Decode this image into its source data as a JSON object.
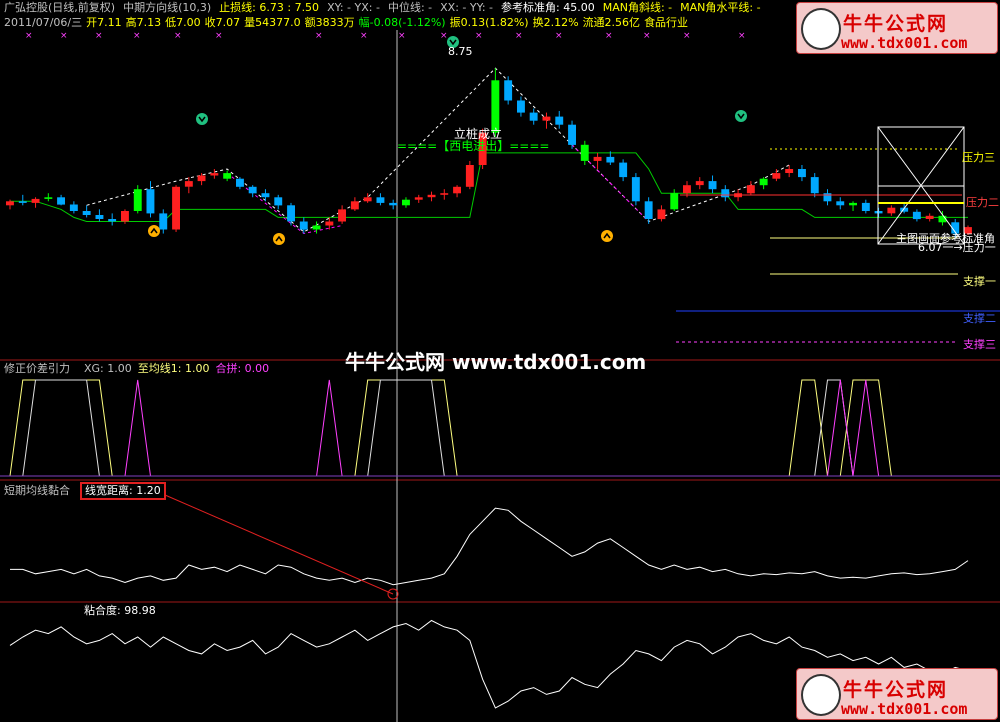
{
  "header": {
    "line1": [
      {
        "t": "广弘控股(日线,前复权)",
        "c": "#c0c0c0"
      },
      {
        "t": "中期方向线(10,3)",
        "c": "#c0c0c0"
      },
      {
        "t": "止损线: 6.73 : 7.50",
        "c": "#ffff00"
      },
      {
        "t": "XY: -  YX: -",
        "c": "#c0c0c0"
      },
      {
        "t": "中位线: -",
        "c": "#c0c0c0"
      },
      {
        "t": "XX: -  YY: -",
        "c": "#c0c0c0"
      },
      {
        "t": "参考标准角: 45.00",
        "c": "#ffffff"
      },
      {
        "t": "MAN角斜线: -",
        "c": "#ffff00"
      },
      {
        "t": "MAN角水平线: -",
        "c": "#ffff00"
      }
    ],
    "line2": [
      {
        "t": "2011/07/06/三",
        "c": "#c0c0c0"
      },
      {
        "t": "开7.11",
        "c": "#ffff00"
      },
      {
        "t": "高7.13",
        "c": "#ffff00"
      },
      {
        "t": "低7.00",
        "c": "#ffff00"
      },
      {
        "t": "收7.07",
        "c": "#ffff00"
      },
      {
        "t": "量54377.0",
        "c": "#ffff00"
      },
      {
        "t": "额3833万",
        "c": "#ffff00"
      },
      {
        "t": "幅-0.08(-1.12%)",
        "c": "#00ff00"
      },
      {
        "t": "振0.13(1.82%)",
        "c": "#ffff00"
      },
      {
        "t": "换2.12%",
        "c": "#ffff00"
      },
      {
        "t": "流通2.56亿",
        "c": "#ffff00"
      },
      {
        "t": "食品行业",
        "c": "#ffff00"
      }
    ]
  },
  "watermark": {
    "site_name": "牛牛公式网",
    "url": "www.tdx001.com",
    "center_text": "牛牛公式网 www.tdx001.com"
  },
  "main_panel": {
    "price_high_label": "8.75",
    "annotation_1": "立桩成立",
    "annotation_2": "====【西电进出】====",
    "right_labels": [
      "压力三",
      "压力二",
      "主图画面参考标准角",
      "6.07一→压力一",
      "支撑一",
      "支撑二",
      "支撑三"
    ],
    "colors": {
      "up": "#ff2020",
      "down": "#00a8ff",
      "flat_up": "#00ff00",
      "stop_line": "#00cc00",
      "dash": "#ffffff",
      "magenta": "#ff00ff"
    }
  },
  "panel2": {
    "title": "修正价差引力",
    "legend": [
      {
        "t": "XG: 1.00",
        "c": "#c0c0c0"
      },
      {
        "t": "至均线1: 1.00",
        "c": "#ffff80"
      },
      {
        "t": "合拼: 0.00",
        "c": "#ff40ff"
      }
    ]
  },
  "panel3": {
    "title": "短期均线黏合",
    "legend": "线宽距离: 1.20"
  },
  "panel4": {
    "legend": "粘合度: 98.98"
  },
  "chart_data": {
    "type": "line",
    "candles": [
      [
        7.05,
        7.12,
        7.0,
        7.1
      ],
      [
        7.1,
        7.18,
        7.05,
        7.08
      ],
      [
        7.08,
        7.15,
        7.02,
        7.13
      ],
      [
        7.13,
        7.2,
        7.1,
        7.15
      ],
      [
        7.15,
        7.18,
        7.05,
        7.06
      ],
      [
        7.06,
        7.1,
        6.95,
        6.98
      ],
      [
        6.98,
        7.05,
        6.9,
        6.93
      ],
      [
        6.93,
        7.0,
        6.85,
        6.88
      ],
      [
        6.88,
        6.95,
        6.8,
        6.85
      ],
      [
        6.85,
        7.0,
        6.82,
        6.98
      ],
      [
        6.98,
        7.3,
        6.95,
        7.25
      ],
      [
        7.25,
        7.35,
        6.9,
        6.95
      ],
      [
        6.95,
        7.0,
        6.7,
        6.75
      ],
      [
        6.75,
        7.3,
        6.72,
        7.28
      ],
      [
        7.28,
        7.4,
        7.2,
        7.35
      ],
      [
        7.35,
        7.45,
        7.3,
        7.42
      ],
      [
        7.42,
        7.5,
        7.38,
        7.45
      ],
      [
        7.45,
        7.48,
        7.35,
        7.38
      ],
      [
        7.38,
        7.4,
        7.25,
        7.28
      ],
      [
        7.28,
        7.3,
        7.15,
        7.2
      ],
      [
        7.2,
        7.25,
        7.1,
        7.15
      ],
      [
        7.15,
        7.18,
        7.0,
        7.05
      ],
      [
        7.05,
        7.08,
        6.8,
        6.85
      ],
      [
        6.85,
        6.9,
        6.7,
        6.75
      ],
      [
        6.75,
        6.85,
        6.7,
        6.8
      ],
      [
        6.8,
        6.9,
        6.75,
        6.85
      ],
      [
        6.85,
        7.05,
        6.82,
        7.0
      ],
      [
        7.0,
        7.15,
        6.98,
        7.1
      ],
      [
        7.1,
        7.2,
        7.08,
        7.15
      ],
      [
        7.15,
        7.2,
        7.05,
        7.08
      ],
      [
        7.08,
        7.12,
        7.0,
        7.05
      ],
      [
        7.05,
        7.15,
        7.02,
        7.12
      ],
      [
        7.12,
        7.18,
        7.08,
        7.15
      ],
      [
        7.15,
        7.22,
        7.1,
        7.18
      ],
      [
        7.18,
        7.25,
        7.12,
        7.2
      ],
      [
        7.2,
        7.3,
        7.15,
        7.28
      ],
      [
        7.28,
        7.6,
        7.25,
        7.55
      ],
      [
        7.55,
        8.0,
        7.5,
        7.95
      ],
      [
        7.95,
        8.75,
        7.9,
        8.6
      ],
      [
        8.6,
        8.65,
        8.3,
        8.35
      ],
      [
        8.35,
        8.4,
        8.15,
        8.2
      ],
      [
        8.2,
        8.25,
        8.05,
        8.1
      ],
      [
        8.1,
        8.2,
        8.0,
        8.15
      ],
      [
        8.15,
        8.22,
        8.0,
        8.05
      ],
      [
        8.05,
        8.1,
        7.75,
        7.8
      ],
      [
        7.8,
        7.85,
        7.55,
        7.6
      ],
      [
        7.6,
        7.7,
        7.5,
        7.65
      ],
      [
        7.65,
        7.72,
        7.55,
        7.58
      ],
      [
        7.58,
        7.62,
        7.35,
        7.4
      ],
      [
        7.4,
        7.45,
        7.05,
        7.1
      ],
      [
        7.1,
        7.15,
        6.82,
        6.88
      ],
      [
        6.88,
        7.05,
        6.85,
        7.0
      ],
      [
        7.0,
        7.25,
        6.98,
        7.2
      ],
      [
        7.2,
        7.35,
        7.15,
        7.3
      ],
      [
        7.3,
        7.4,
        7.25,
        7.35
      ],
      [
        7.35,
        7.42,
        7.2,
        7.25
      ],
      [
        7.25,
        7.3,
        7.1,
        7.15
      ],
      [
        7.15,
        7.25,
        7.1,
        7.2
      ],
      [
        7.2,
        7.35,
        7.18,
        7.3
      ],
      [
        7.3,
        7.4,
        7.25,
        7.38
      ],
      [
        7.38,
        7.5,
        7.35,
        7.45
      ],
      [
        7.45,
        7.55,
        7.4,
        7.5
      ],
      [
        7.5,
        7.55,
        7.35,
        7.4
      ],
      [
        7.4,
        7.45,
        7.15,
        7.2
      ],
      [
        7.2,
        7.25,
        7.05,
        7.1
      ],
      [
        7.1,
        7.15,
        7.0,
        7.05
      ],
      [
        7.05,
        7.1,
        6.98,
        7.08
      ],
      [
        7.08,
        7.12,
        6.95,
        6.98
      ],
      [
        6.98,
        7.02,
        6.9,
        6.95
      ],
      [
        6.95,
        7.05,
        6.92,
        7.02
      ],
      [
        7.02,
        7.08,
        6.95,
        6.97
      ],
      [
        6.97,
        7.0,
        6.85,
        6.88
      ],
      [
        6.88,
        6.95,
        6.85,
        6.92
      ],
      [
        6.92,
        6.98,
        6.8,
        6.84
      ],
      [
        6.84,
        6.88,
        6.65,
        6.7
      ],
      [
        6.7,
        6.8,
        6.68,
        6.78
      ]
    ],
    "stop_line": [
      7.1,
      7.1,
      7.1,
      7.05,
      7.0,
      6.9,
      6.85,
      6.85,
      6.85,
      6.85,
      6.85,
      6.85,
      6.85,
      7.0,
      7.0,
      7.0,
      7.0,
      7.0,
      7.0,
      7.0,
      7.0,
      6.9,
      6.9,
      6.9,
      6.9,
      6.9,
      6.9,
      6.9,
      6.9,
      6.9,
      6.9,
      6.9,
      6.9,
      6.9,
      6.9,
      6.9,
      6.9,
      7.7,
      7.7,
      7.7,
      7.7,
      7.7,
      7.7,
      7.7,
      7.7,
      7.7,
      7.7,
      7.7,
      7.7,
      7.7,
      7.5,
      7.2,
      7.2,
      7.2,
      7.2,
      7.2,
      7.2,
      7.0,
      7.0,
      7.0,
      7.0,
      7.0,
      7.0,
      6.9,
      6.9,
      6.9,
      6.9,
      6.9,
      6.9,
      6.9,
      6.9,
      6.9,
      6.9,
      6.9,
      6.9,
      6.9
    ],
    "panel2_xg": [
      0,
      0,
      1,
      1,
      1,
      1,
      1,
      0,
      0,
      0,
      0,
      0,
      0,
      0,
      0,
      0,
      0,
      0,
      0,
      0,
      0,
      0,
      0,
      0,
      0,
      0,
      0,
      0,
      0,
      1,
      1,
      1,
      1,
      1,
      0,
      0,
      0,
      0,
      0,
      0,
      0,
      0,
      0,
      0,
      0,
      0,
      0,
      0,
      0,
      0,
      0,
      0,
      0,
      0,
      0,
      0,
      0,
      0,
      0,
      0,
      0,
      0,
      0,
      0,
      1,
      1,
      0,
      0,
      0,
      0,
      0,
      0,
      0,
      0,
      0,
      0
    ],
    "panel2_ma": [
      0,
      1,
      1,
      1,
      1,
      1,
      1,
      1,
      0,
      0,
      0,
      0,
      0,
      0,
      0,
      0,
      0,
      0,
      0,
      0,
      0,
      0,
      0,
      0,
      0,
      0,
      0,
      0,
      1,
      1,
      1,
      1,
      1,
      1,
      1,
      0,
      0,
      0,
      0,
      0,
      0,
      0,
      0,
      0,
      0,
      0,
      0,
      0,
      0,
      0,
      0,
      0,
      0,
      0,
      0,
      0,
      0,
      0,
      0,
      0,
      0,
      0,
      1,
      1,
      0,
      0,
      1,
      1,
      1,
      0,
      0,
      0,
      0,
      0,
      0,
      0
    ],
    "panel2_hp": [
      0,
      0,
      0,
      0,
      0,
      0,
      0,
      0,
      0,
      0,
      1,
      0,
      0,
      0,
      0,
      0,
      0,
      0,
      0,
      0,
      0,
      0,
      0,
      0,
      0,
      1,
      0,
      0,
      0,
      0,
      0,
      0,
      0,
      0,
      0,
      0,
      0,
      0,
      0,
      0,
      0,
      0,
      0,
      0,
      0,
      0,
      0,
      0,
      0,
      0,
      0,
      0,
      0,
      0,
      0,
      0,
      0,
      0,
      0,
      0,
      0,
      0,
      0,
      0,
      0,
      1,
      0,
      1,
      0,
      0,
      0,
      0,
      0,
      0,
      0,
      0
    ],
    "panel3_line": [
      1.5,
      1.5,
      1.4,
      1.45,
      1.5,
      1.4,
      1.5,
      1.35,
      1.3,
      1.2,
      1.3,
      1.35,
      1.25,
      1.3,
      1.6,
      1.5,
      1.55,
      1.45,
      1.6,
      1.5,
      1.4,
      1.6,
      1.55,
      1.4,
      1.3,
      1.25,
      1.3,
      1.2,
      1.3,
      1.25,
      1.15,
      1.2,
      1.25,
      1.3,
      1.4,
      1.8,
      2.3,
      2.6,
      2.9,
      2.85,
      2.6,
      2.4,
      2.2,
      2.0,
      1.8,
      1.9,
      2.1,
      2.2,
      2.0,
      1.8,
      1.6,
      1.5,
      1.6,
      1.5,
      1.55,
      1.45,
      1.5,
      1.4,
      1.35,
      1.4,
      1.38,
      1.42,
      1.4,
      1.45,
      1.35,
      1.3,
      1.32,
      1.3,
      1.35,
      1.4,
      1.42,
      1.38,
      1.4,
      1.45,
      1.5,
      1.7
    ],
    "panel4_line": [
      97.5,
      98.0,
      98.4,
      98.2,
      98.6,
      98.0,
      97.6,
      97.8,
      98.2,
      97.6,
      98.0,
      97.4,
      98.0,
      97.6,
      97.2,
      97.0,
      97.6,
      97.2,
      97.4,
      97.8,
      97.0,
      97.4,
      98.2,
      97.8,
      97.4,
      97.6,
      98.0,
      98.4,
      97.8,
      98.2,
      98.6,
      98.8,
      98.4,
      98.98,
      98.6,
      98.4,
      97.8,
      95.5,
      93.8,
      94.2,
      94.8,
      95.0,
      94.6,
      94.8,
      95.6,
      95.2,
      95.0,
      95.8,
      96.4,
      97.2,
      97.0,
      96.6,
      97.4,
      97.8,
      97.6,
      97.0,
      97.4,
      98.0,
      98.2,
      97.8,
      97.6,
      98.0,
      97.4,
      97.2,
      96.8,
      97.0,
      96.6,
      96.8,
      96.4,
      96.8,
      96.2,
      96.4,
      96.0,
      95.8,
      96.2,
      96.0
    ],
    "ylim_main": [
      6.0,
      9.1
    ],
    "ylim_panel3": [
      0.8,
      3.2
    ],
    "ylim_panel4": [
      93.2,
      99.6
    ]
  }
}
